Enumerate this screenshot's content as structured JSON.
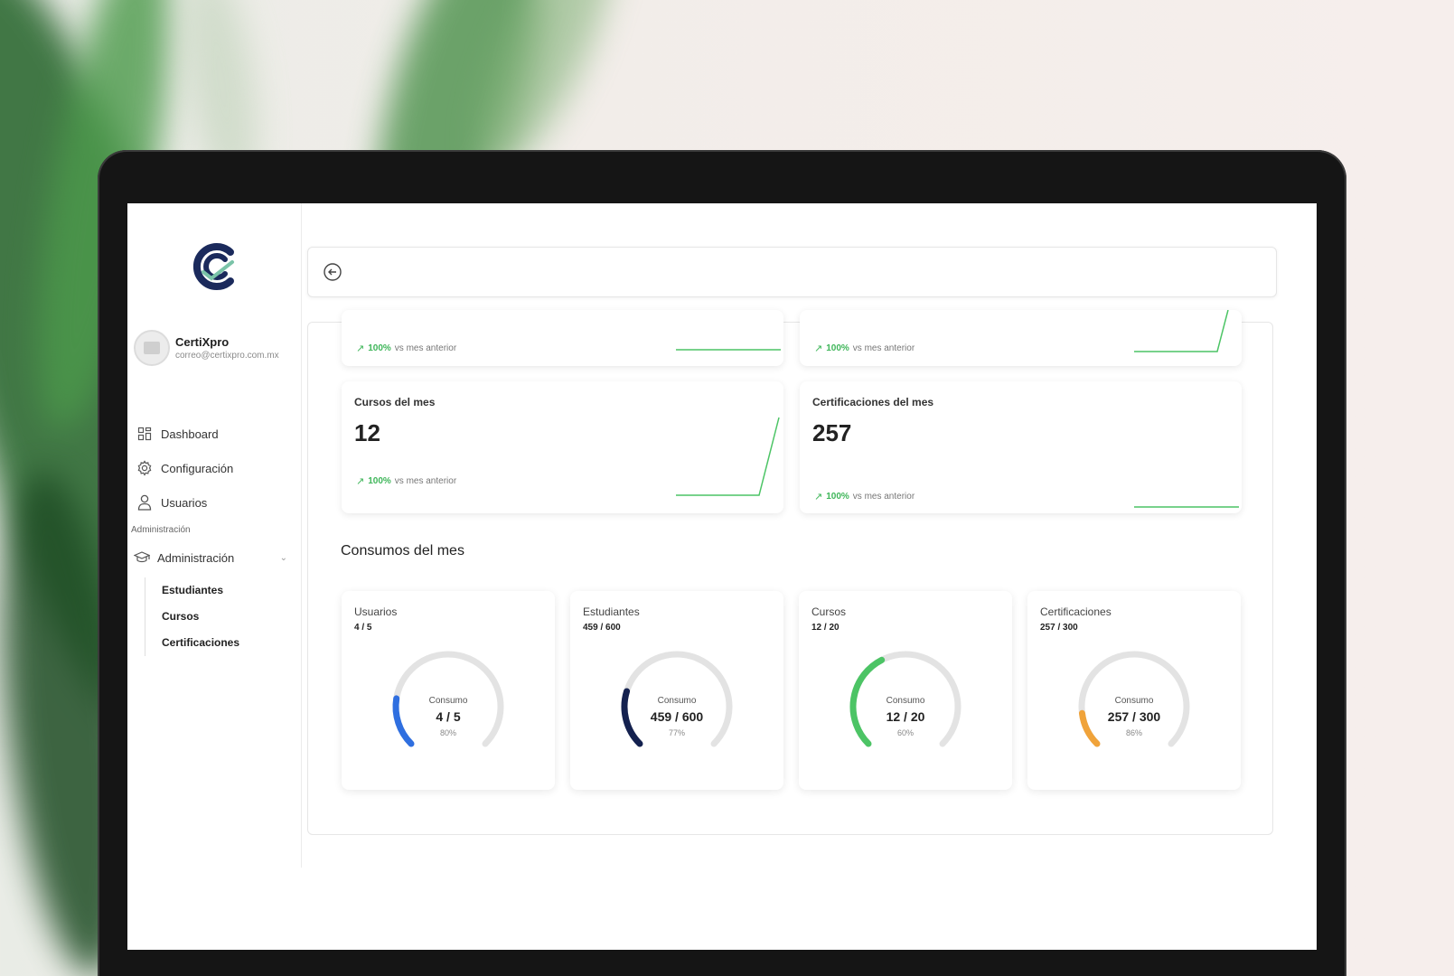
{
  "app": {
    "name": "CertiXpro",
    "email": "correo@certixpro.com.mx"
  },
  "sidebar": {
    "items": [
      {
        "label": "Dashboard",
        "icon": "grid-icon"
      },
      {
        "label": "Configuración",
        "icon": "gear-icon"
      },
      {
        "label": "Usuarios",
        "icon": "user-icon"
      }
    ],
    "section_label": "Administración",
    "admin": {
      "label": "Administración",
      "icon": "graduation-cap-icon"
    },
    "subitems": [
      "Estudiantes",
      "Cursos",
      "Certificaciones"
    ]
  },
  "stats": [
    {
      "title": "",
      "value": "",
      "trend_pct": "100%",
      "trend_text": "vs mes anterior"
    },
    {
      "title": "",
      "value": "",
      "trend_pct": "100%",
      "trend_text": "vs mes anterior"
    },
    {
      "title": "Cursos del mes",
      "value": "12",
      "trend_pct": "100%",
      "trend_text": "vs mes anterior"
    },
    {
      "title": "Certificaciones del mes",
      "value": "257",
      "trend_pct": "100%",
      "trend_text": "vs mes anterior"
    }
  ],
  "consumption": {
    "title": "Consumos del mes",
    "label": "Consumo",
    "cards": [
      {
        "title": "Usuarios",
        "summary": "4 / 5",
        "value": "4 / 5",
        "percent_text": "80%",
        "fraction": 0.2,
        "color": "#2f6fe0"
      },
      {
        "title": "Estudiantes",
        "summary": "459 / 600",
        "value": "459 / 600",
        "percent_text": "77%",
        "fraction": 0.23,
        "color": "#14214f"
      },
      {
        "title": "Cursos",
        "summary": "12 / 20",
        "value": "12 / 20",
        "percent_text": "60%",
        "fraction": 0.4,
        "color": "#4cc465"
      },
      {
        "title": "Certificaciones",
        "summary": "257 / 300",
        "value": "257 / 300",
        "percent_text": "86%",
        "fraction": 0.14,
        "color": "#f0a33a"
      }
    ]
  },
  "colors": {
    "trend_green": "#3fb65a",
    "brand_navy": "#1b2a5c",
    "brand_teal": "#7ac3a8"
  }
}
